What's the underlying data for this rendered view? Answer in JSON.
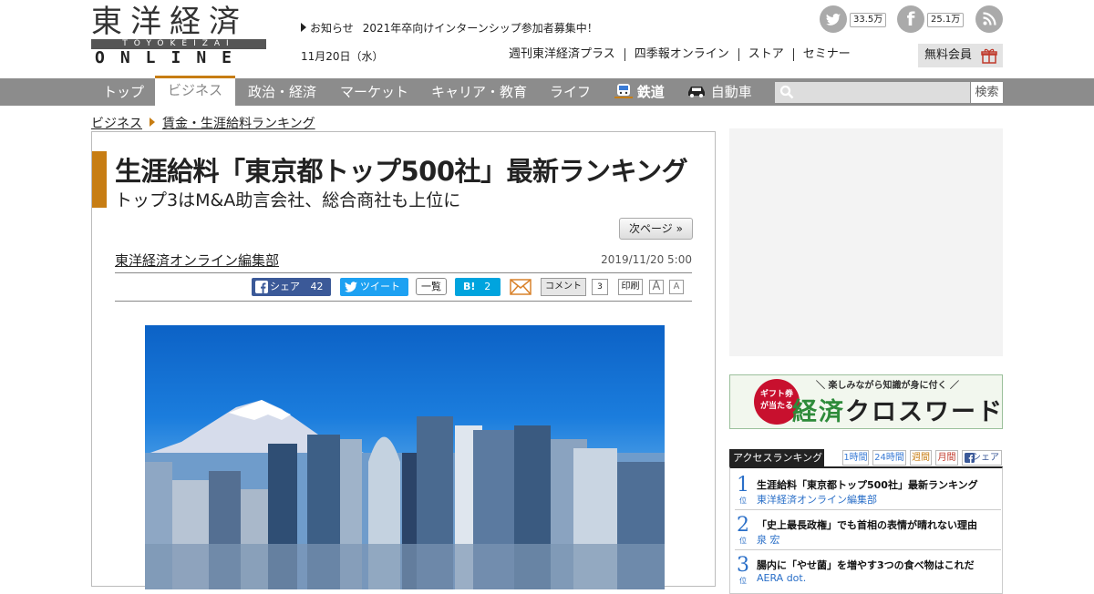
{
  "brand": {
    "logo_main": "東洋経済",
    "logo_sub": "TOYOKEIZAI",
    "logo_online": "ONLINE"
  },
  "header": {
    "notice_label": "お知らせ",
    "notice_text": "2021年卒向けインターンシップ参加者募集中！",
    "date": "11月20日（水）",
    "links": [
      "週刊東洋経済プラス",
      "四季報オンライン",
      "ストア",
      "セミナー"
    ],
    "member_button": "無料会員",
    "social": {
      "twitter_count": "33.5万",
      "facebook_count": "25.1万"
    }
  },
  "nav": {
    "items": [
      "トップ",
      "ビジネス",
      "政治・経済",
      "マーケット",
      "キャリア・教育",
      "ライフ",
      "鉄道",
      "自動車"
    ],
    "active": "ビジネス",
    "search_button": "検索"
  },
  "breadcrumb": [
    "ビジネス",
    "賃金・生涯給料ランキング"
  ],
  "article": {
    "title": "生涯給料「東京都トップ500社」最新ランキング",
    "subtitle": "トップ3はM&A助言会社、総合商社も上位に",
    "next_button": "次ページ »",
    "author": "東洋経済オンライン編集部",
    "published": "2019/11/20 5:00",
    "share": {
      "facebook_label": "シェア",
      "facebook_count": "42",
      "tweet_label": "ツイート",
      "list_label": "一覧",
      "hatena_label": "B!",
      "hatena_count": "2",
      "comment_label": "コメント",
      "comment_count": "3",
      "print_label": "印刷",
      "font_large": "A",
      "font_small": "A"
    }
  },
  "sidebar": {
    "banner": {
      "badge_line1": "ギフト券",
      "badge_line2": "が当たる",
      "tagline": "楽しみながら知識が身に付く",
      "title_kanji": "経済",
      "title_kana": "クロスワード"
    },
    "ranking": {
      "heading": "アクセスランキング",
      "tabs": [
        "1時間",
        "24時間",
        "週間",
        "月間",
        "シェア"
      ],
      "rank_suffix": "位",
      "items": [
        {
          "rank": "1",
          "title": "生涯給料「東京都トップ500社」最新ランキング",
          "author": "東洋経済オンライン編集部"
        },
        {
          "rank": "2",
          "title": "「史上最長政権」でも首相の表情が晴れない理由",
          "author": "泉 宏"
        },
        {
          "rank": "3",
          "title": "腸内に「やせ菌」を増やす3つの食べ物はこれだ",
          "author": "AERA dot."
        }
      ]
    }
  },
  "colors": {
    "accent": "#c77d13",
    "nav_bg": "#8c8c8c",
    "link_blue": "#2a6fc8",
    "facebook": "#3b5998",
    "twitter": "#1da1f2",
    "hatena": "#00a4de"
  }
}
